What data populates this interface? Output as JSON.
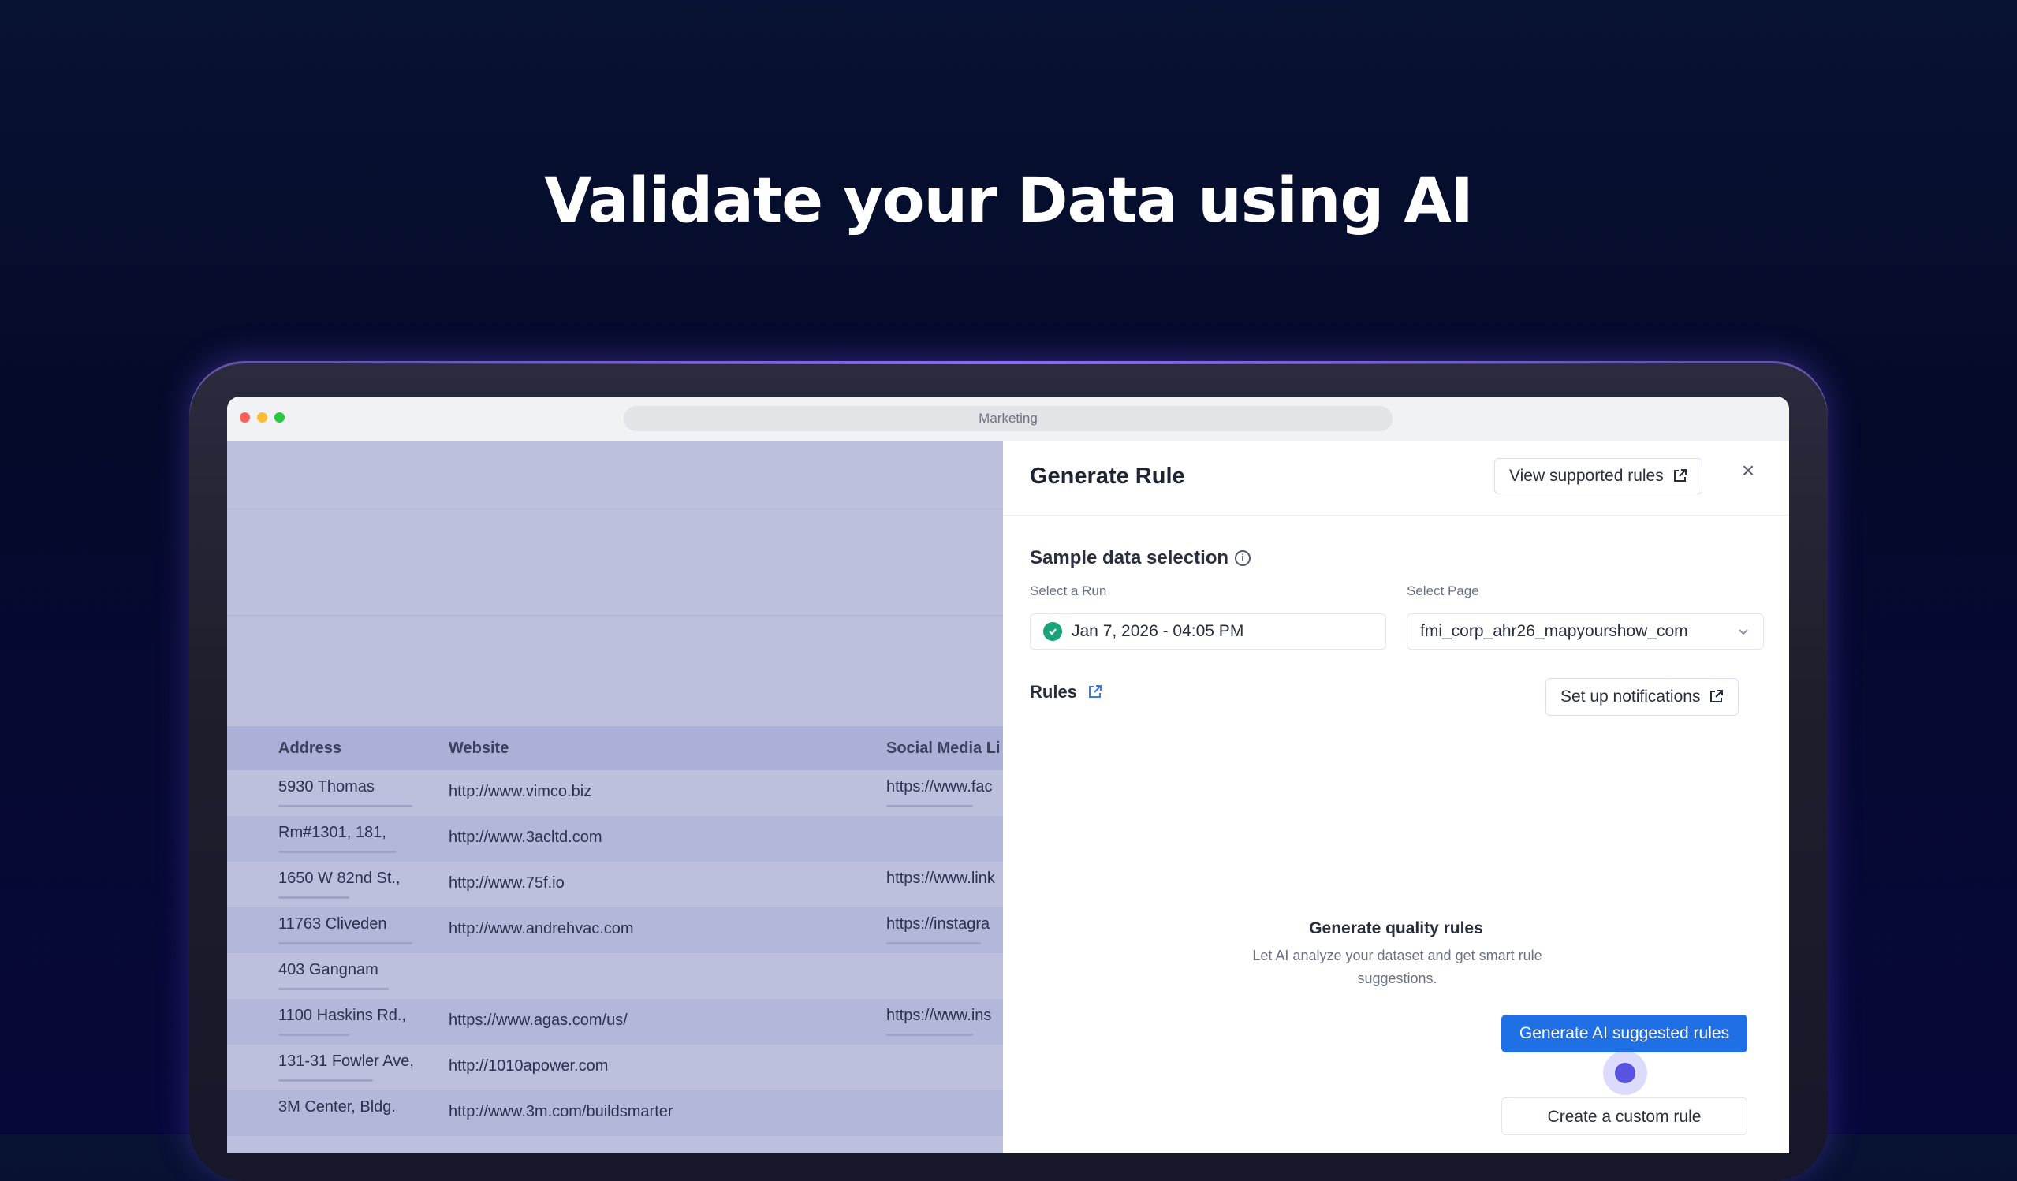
{
  "headline": "Validate your Data using AI",
  "window": {
    "url_title": "Marketing"
  },
  "table": {
    "columns": [
      "Address",
      "Website",
      "Social Media Li"
    ],
    "rows": [
      {
        "address": "5930 Thomas",
        "website": "http://www.vimco.biz",
        "social": "https://www.fac"
      },
      {
        "address": "Rm#1301, 181,",
        "website": "http://www.3acltd.com",
        "social": ""
      },
      {
        "address": "1650 W 82nd St.,",
        "website": "http://www.75f.io",
        "social": "https://www.link"
      },
      {
        "address": "11763 Cliveden",
        "website": "http://www.andrehvac.com",
        "social": "https://instagra"
      },
      {
        "address": "403 Gangnam",
        "website": "",
        "social": ""
      },
      {
        "address": "1100 Haskins Rd.,",
        "website": "https://www.agas.com/us/",
        "social": "https://www.ins"
      },
      {
        "address": "131-31 Fowler Ave,",
        "website": "http://1010apower.com",
        "social": ""
      },
      {
        "address": "3M Center, Bldg.",
        "website": "http://www.3m.com/buildsmarter",
        "social": ""
      }
    ]
  },
  "panel": {
    "title": "Generate Rule",
    "view_supported_rules": "View supported rules",
    "sample_section": "Sample data selection",
    "run_label": "Select a Run",
    "run_value": "Jan 7, 2026 - 04:05 PM",
    "page_label": "Select Page",
    "page_value": "fmi_corp_ahr26_mapyourshow_com",
    "rules_label": "Rules",
    "setup_notifications": "Set up notifications",
    "empty_title": "Generate quality rules",
    "empty_desc": "Let AI analyze your dataset and get smart rule suggestions.",
    "primary_button": "Generate AI suggested rules",
    "secondary_button": "Create a custom rule"
  },
  "colors": {
    "primary": "#1f6fe5",
    "success": "#1aa37a",
    "background": "#050a2a",
    "overlay": "#bcc0dd"
  }
}
